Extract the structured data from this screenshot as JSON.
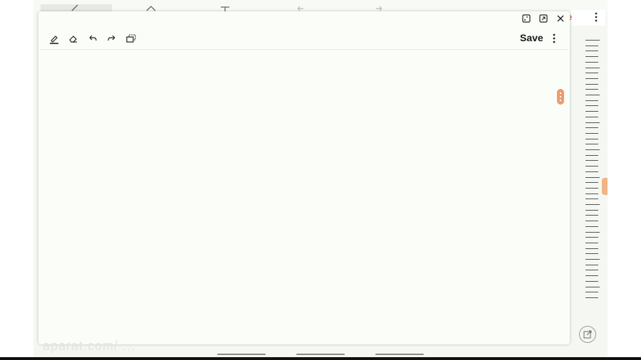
{
  "note": {
    "save_label": "Save",
    "toolbar": {
      "pen": "pen-icon",
      "eraser": "eraser-icon",
      "undo": "undo-icon",
      "redo": "redo-icon",
      "select": "selection-icon"
    },
    "window_controls": [
      "minimize-to-icon",
      "expand-icon",
      "close-icon"
    ]
  },
  "background_app": {
    "save_label_partial": "ve",
    "accent_color": "#e0603a"
  },
  "watermark": "aparat.com/ ...",
  "colors": {
    "scroll_handle": "#ee9b6d",
    "background": "#f5f8f2",
    "note_surface": "#fbfdf9"
  }
}
